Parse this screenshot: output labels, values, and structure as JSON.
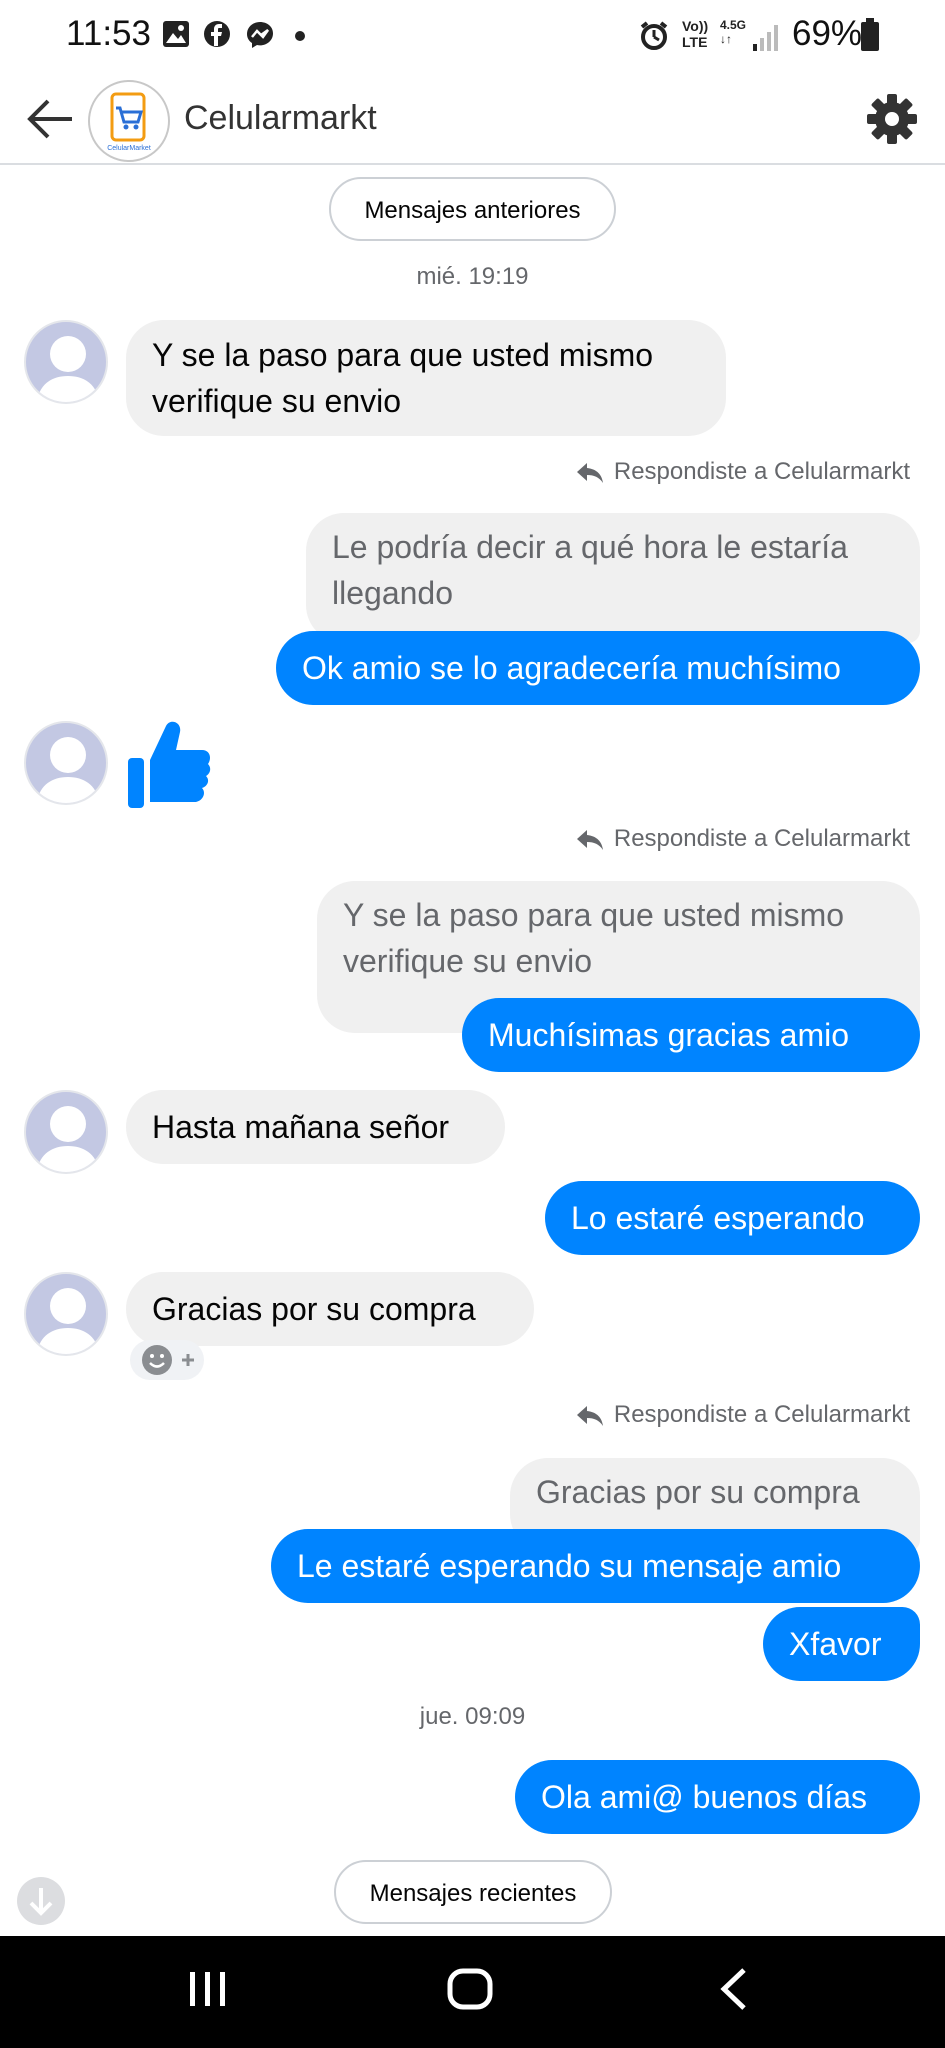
{
  "status_bar": {
    "time": "11:53",
    "battery": "69%",
    "network_top": "Vo))",
    "network_bottom": "LTE",
    "network_gen": "4.5G"
  },
  "header": {
    "contact_name": "Celularmarkt",
    "logo_text": "CelularMarket"
  },
  "pills": {
    "older": "Mensajes anteriores",
    "recent": "Mensajes recientes"
  },
  "timestamps": {
    "first": "mié. 19:19",
    "second": "jue. 09:09"
  },
  "messages": {
    "m1": "Y se la paso para que usted mismo verifique su envio",
    "replied_label": "Respondiste a Celularmarkt",
    "q1": "Le podría decir a qué hora le estaría llegando",
    "m2": "Ok amio se lo agradecería muchísimo",
    "q2": "Y se la paso para que usted mismo verifique su envio",
    "m3": "Muchísimas gracias amio",
    "m4": "Hasta mañana señor",
    "m5": "Lo estaré esperando",
    "m6": "Gracias por su compra",
    "q3": "Gracias por su compra",
    "m7": "Le estaré esperando su mensaje amio",
    "m8": "Xfavor",
    "m9": "Ola ami@ buenos días"
  },
  "colors": {
    "accent": "#0084ff",
    "incoming_bubble": "#f0f0f0",
    "meta_text": "#65676b"
  },
  "icons": [
    "back-arrow-icon",
    "gear-icon",
    "thumbs-up-icon",
    "reply-icon",
    "emoji-react-icon",
    "scroll-down-icon"
  ]
}
